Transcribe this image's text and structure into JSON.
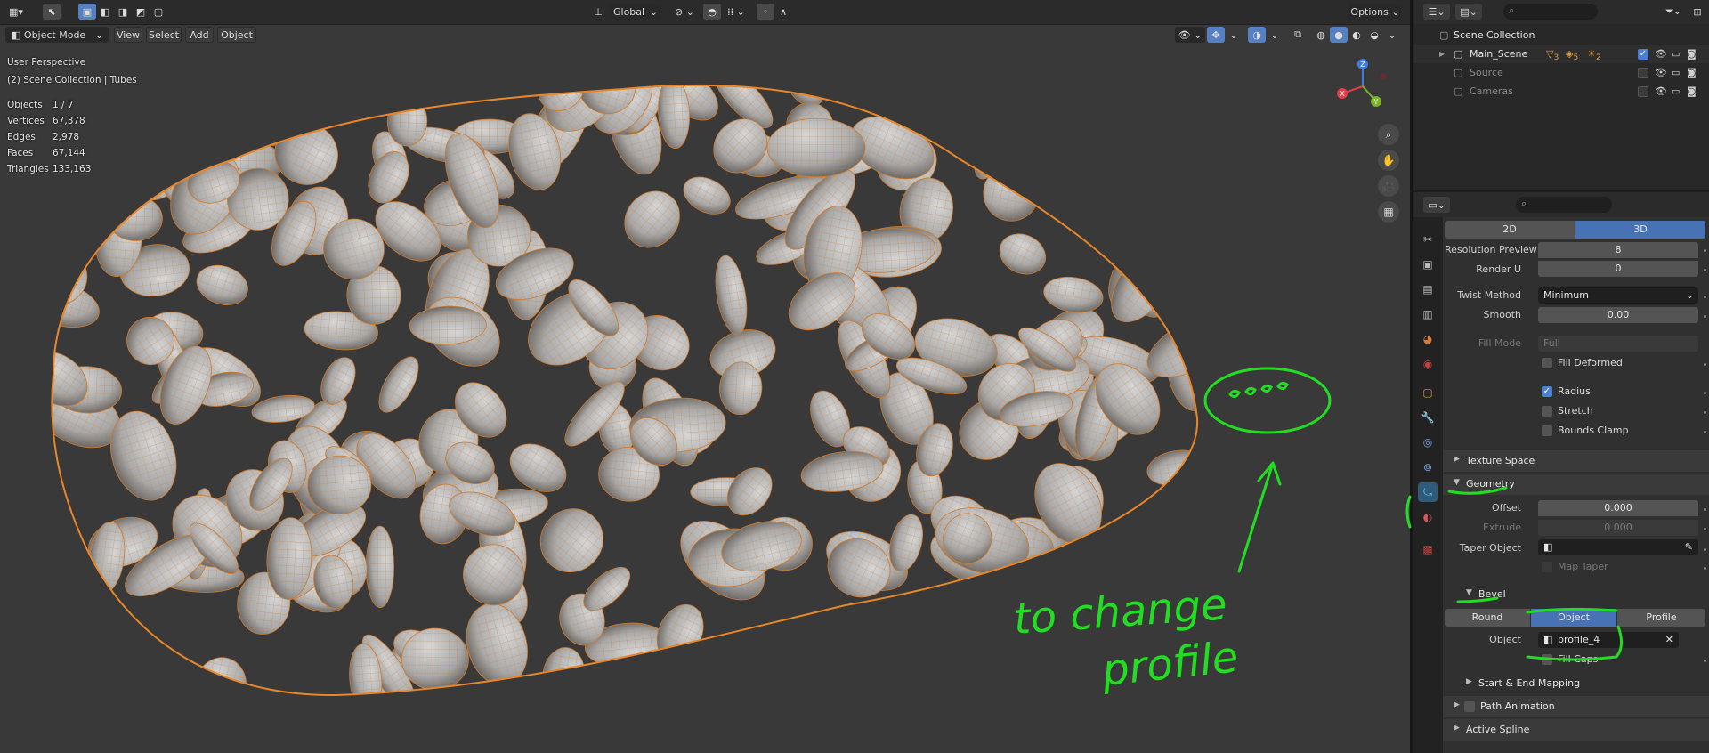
{
  "viewport_header": {
    "mode": "Object Mode",
    "menus": [
      "View",
      "Select",
      "Add",
      "Object"
    ],
    "transform_orientation": "Global",
    "options": "Options"
  },
  "overlay": {
    "perspective": "User Perspective",
    "collection": "(2) Scene Collection | Tubes",
    "stats": [
      {
        "label": "Objects",
        "value": "1 / 7"
      },
      {
        "label": "Vertices",
        "value": "67,378"
      },
      {
        "label": "Edges",
        "value": "2,978"
      },
      {
        "label": "Faces",
        "value": "67,144"
      },
      {
        "label": "Triangles",
        "value": "133,163"
      }
    ]
  },
  "gizmo": {
    "x": "X",
    "y": "Y",
    "z": "Z"
  },
  "outliner": {
    "root": "Scene Collection",
    "items": [
      {
        "name": "Main_Scene",
        "enabled": true,
        "badges": [
          "3",
          "5",
          "2"
        ]
      },
      {
        "name": "Source",
        "enabled": false
      },
      {
        "name": "Cameras",
        "enabled": false
      }
    ]
  },
  "properties": {
    "dimension_tabs": [
      "2D",
      "3D"
    ],
    "active_dimension": "3D",
    "resolution_preview_u": {
      "label": "Resolution Preview U",
      "value": "8"
    },
    "render_u": {
      "label": "Render U",
      "value": "0"
    },
    "twist_method": {
      "label": "Twist Method",
      "value": "Minimum"
    },
    "smooth": {
      "label": "Smooth",
      "value": "0.00"
    },
    "fill_mode": {
      "label": "Fill Mode",
      "value": "Full"
    },
    "fill_deformed": "Fill Deformed",
    "radius": "Radius",
    "stretch": "Stretch",
    "bounds_clamp": "Bounds Clamp",
    "texture_space": "Texture Space",
    "geometry": {
      "title": "Geometry",
      "offset": {
        "label": "Offset",
        "value": "0.000"
      },
      "extrude": {
        "label": "Extrude",
        "value": "0.000"
      },
      "taper_object": {
        "label": "Taper Object",
        "value": ""
      },
      "map_taper": "Map Taper"
    },
    "bevel": {
      "title": "Bevel",
      "modes": [
        "Round",
        "Object",
        "Profile"
      ],
      "active_mode": "Object",
      "object": {
        "label": "Object",
        "value": "profile_4"
      },
      "fill_caps": "Fill Caps"
    },
    "collapsed_panels": [
      "Start & End Mapping",
      "Path Animation",
      "Active Spline"
    ]
  },
  "annotation": {
    "note_line1": "to change",
    "note_line2": "profile",
    "color": "#22dd22"
  }
}
